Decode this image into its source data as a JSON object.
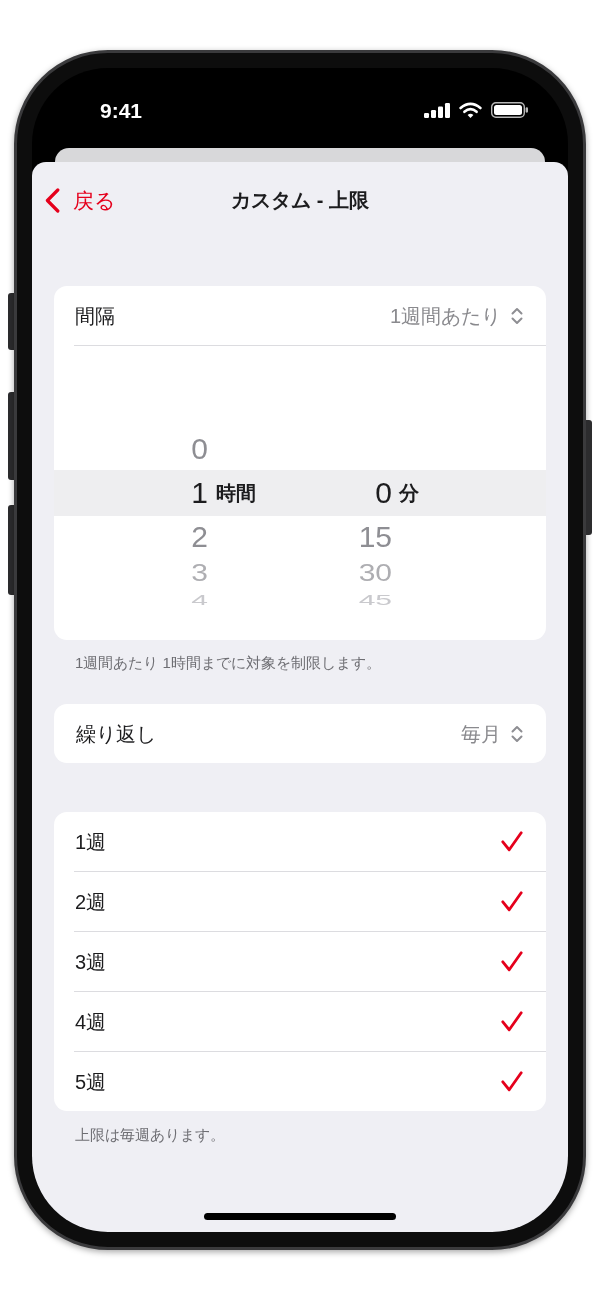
{
  "status_bar": {
    "time": "9:41"
  },
  "nav": {
    "back": "戻る",
    "title": "カスタム - 上限"
  },
  "interval": {
    "label": "間隔",
    "value": "1週間あたり"
  },
  "picker": {
    "columns": [
      {
        "unit": "時間",
        "items": [
          {
            "value": "0",
            "selected": false
          },
          {
            "value": "1",
            "selected": true
          },
          {
            "value": "2",
            "selected": false
          },
          {
            "value": "3",
            "selected": false
          },
          {
            "value": "4",
            "selected": false
          }
        ]
      },
      {
        "unit": "分",
        "items": [
          {
            "value": "0",
            "selected": true
          },
          {
            "value": "15",
            "selected": false
          },
          {
            "value": "30",
            "selected": false
          },
          {
            "value": "45",
            "selected": false
          }
        ]
      }
    ]
  },
  "interval_footer": "1週間あたり 1時間までに対象を制限します。",
  "repeat": {
    "label": "繰り返し",
    "value": "毎月"
  },
  "weeks": [
    {
      "label": "1週",
      "checked": true
    },
    {
      "label": "2週",
      "checked": true
    },
    {
      "label": "3週",
      "checked": true
    },
    {
      "label": "4週",
      "checked": true
    },
    {
      "label": "5週",
      "checked": true
    }
  ],
  "weeks_footer": "上限は毎週あります。"
}
